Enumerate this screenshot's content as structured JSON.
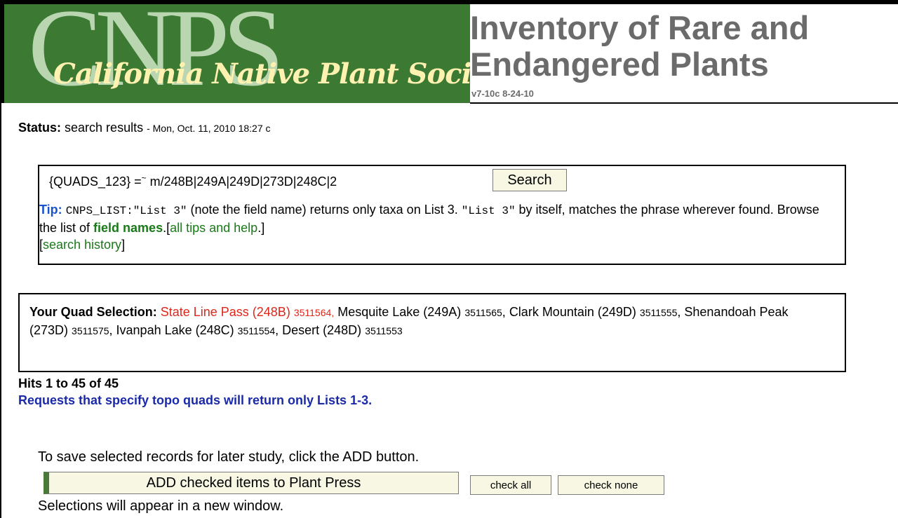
{
  "header": {
    "logo_big": "CNPS",
    "logo_script": "California Native Plant Society",
    "title": "Inventory of Rare and Endangered Plants",
    "version": "v7-10c 8-24-10"
  },
  "status": {
    "label": "Status:",
    "value": "search results",
    "timestamp": "- Mon, Oct. 11, 2010 18:27 c"
  },
  "search": {
    "query_prefix": "{QUADS_123} =",
    "query_sup": "~",
    "query_rest": " m/248B|249A|249D|273D|248C|2",
    "button_label": "Search"
  },
  "tip": {
    "label": "Tip:",
    "code1": "CNPS_LIST:\"List 3\"",
    "text1": " (note the field name) returns only taxa on List 3. ",
    "code2": "\"List 3\"",
    "text2": " by itself, matches the phrase wherever found. Browse the list of ",
    "field_names_link": "field names",
    "text3": ".[",
    "all_tips_link": "all tips and help",
    "text4": ".]",
    "text5": "[",
    "search_history_link": "search history",
    "text6": "]"
  },
  "quads": {
    "label": "Your Quad Selection:",
    "selected_name": "State Line Pass (248B)",
    "selected_code": "3511564,",
    "items": [
      {
        "name": "Mesquite Lake (249A)",
        "code": "3511565"
      },
      {
        "name": "Clark Mountain (249D)",
        "code": "3511555"
      },
      {
        "name": "Shenandoah Peak (273D)",
        "code": "3511575"
      },
      {
        "name": "Ivanpah Lake (248C)",
        "code": "3511554"
      },
      {
        "name": "Desert (248D)",
        "code": "3511553"
      }
    ]
  },
  "results": {
    "hits": "Hits 1 to 45 of 45",
    "note": "Requests that specify topo quads will return only Lists 1-3."
  },
  "actions": {
    "save_note": "To save selected records for later study, click the ADD button.",
    "add_button": "ADD checked items to Plant Press",
    "check_all": "check all",
    "check_none": "check none",
    "selections_note": "Selections will appear in a new window."
  },
  "colors": {
    "logo_green": "#3c7a34",
    "link_green": "#1a7a1a",
    "tip_blue": "#1a53cc",
    "note_blue": "#1a2aa8",
    "selected_red": "#e0261a",
    "title_gray": "#6b6b6b"
  }
}
